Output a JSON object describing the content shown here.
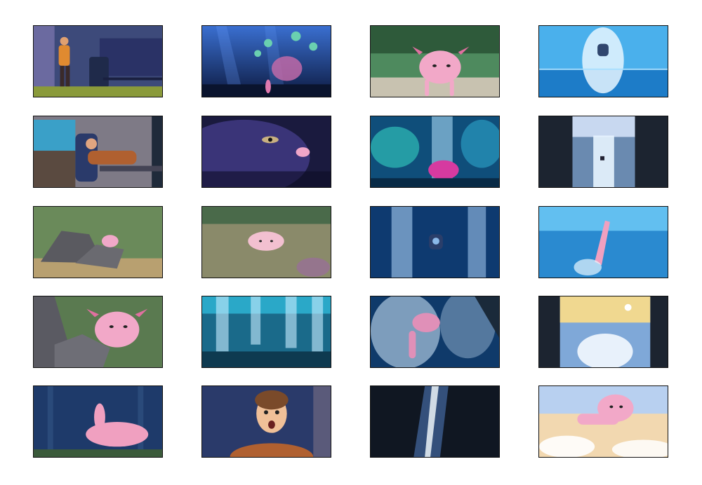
{
  "storyboard": {
    "columns": 4,
    "rows": 5,
    "panels": [
      {
        "scene": "man-at-desk",
        "palette": "indigo"
      },
      {
        "scene": "jellyfish-reef",
        "palette": "deep-blue"
      },
      {
        "scene": "axolotl-swimming",
        "palette": "aquarium"
      },
      {
        "scene": "diver-splash",
        "palette": "ocean"
      },
      {
        "scene": "man-reclining-chair",
        "palette": "indigo"
      },
      {
        "scene": "whale-eye-axolotl",
        "palette": "violet"
      },
      {
        "scene": "coral-vent",
        "palette": "teal"
      },
      {
        "scene": "portal-waterfall",
        "palette": "dark"
      },
      {
        "scene": "axolotl-on-rocks",
        "palette": "aquarium"
      },
      {
        "scene": "axolotl-in-sand",
        "palette": "aquarium"
      },
      {
        "scene": "diver-bubbles",
        "palette": "deep-blue"
      },
      {
        "scene": "axolotl-rising",
        "palette": "ocean"
      },
      {
        "scene": "axolotl-closeup-rocks",
        "palette": "aquarium"
      },
      {
        "scene": "bubble-columns",
        "palette": "teal"
      },
      {
        "scene": "axolotl-bubbles",
        "palette": "deep-blue"
      },
      {
        "scene": "portal-splash-sky",
        "palette": "sky"
      },
      {
        "scene": "axolotl-tail-forest",
        "palette": "deep-blue"
      },
      {
        "scene": "man-surprised",
        "palette": "indigo"
      },
      {
        "scene": "portal-light-beam",
        "palette": "dark"
      },
      {
        "scene": "axolotl-flying-sky",
        "palette": "sky"
      }
    ]
  }
}
